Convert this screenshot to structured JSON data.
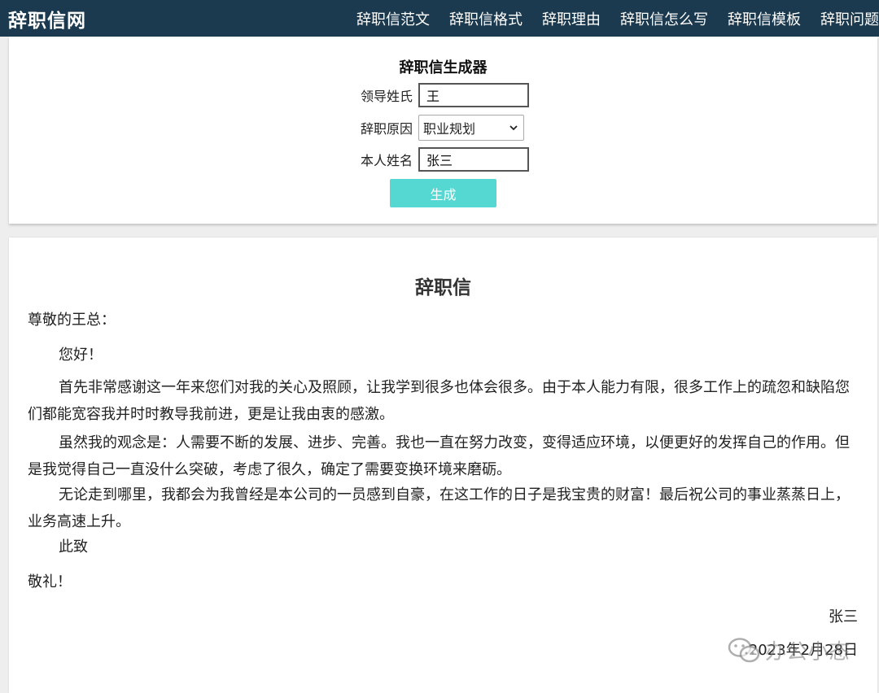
{
  "header": {
    "brand": "辞职信网",
    "nav": [
      "辞职信范文",
      "辞职信格式",
      "辞职理由",
      "辞职信怎么写",
      "辞职信模板",
      "辞职问题"
    ]
  },
  "generator": {
    "title": "辞职信生成器",
    "leader_label": "领导姓氏",
    "leader_value": "王",
    "reason_label": "辞职原因",
    "reason_selected": "职业规划",
    "name_label": "本人姓名",
    "name_value": "张三",
    "button": "生成"
  },
  "letter": {
    "title": "辞职信",
    "salutation": "尊敬的王总：",
    "greeting": "您好！",
    "p1": "首先非常感谢这一年来您们对我的关心及照顾，让我学到很多也体会很多。由于本人能力有限，很多工作上的疏忽和缺陷您们都能宽容我并时时教导我前进，更是让我由衷的感激。",
    "p2": "虽然我的观念是：人需要不断的发展、进步、完善。我也一直在努力改变，变得适应环境，以便更好的发挥自己的作用。但是我觉得自己一直没什么突破，考虑了很久，确定了需要变换环境来磨砺。",
    "p3": "无论走到哪里，我都会为我曾经是本公司的一员感到自豪，在这工作的日子是我宝贵的财富！最后祝公司的事业蒸蒸日上，业务高速上升。",
    "closing1": "此致",
    "closing2": "敬礼！",
    "signature": "张三",
    "date": "2023年2月28日"
  },
  "watermark": {
    "icon": "wechat-icon",
    "text": "办公小态"
  }
}
